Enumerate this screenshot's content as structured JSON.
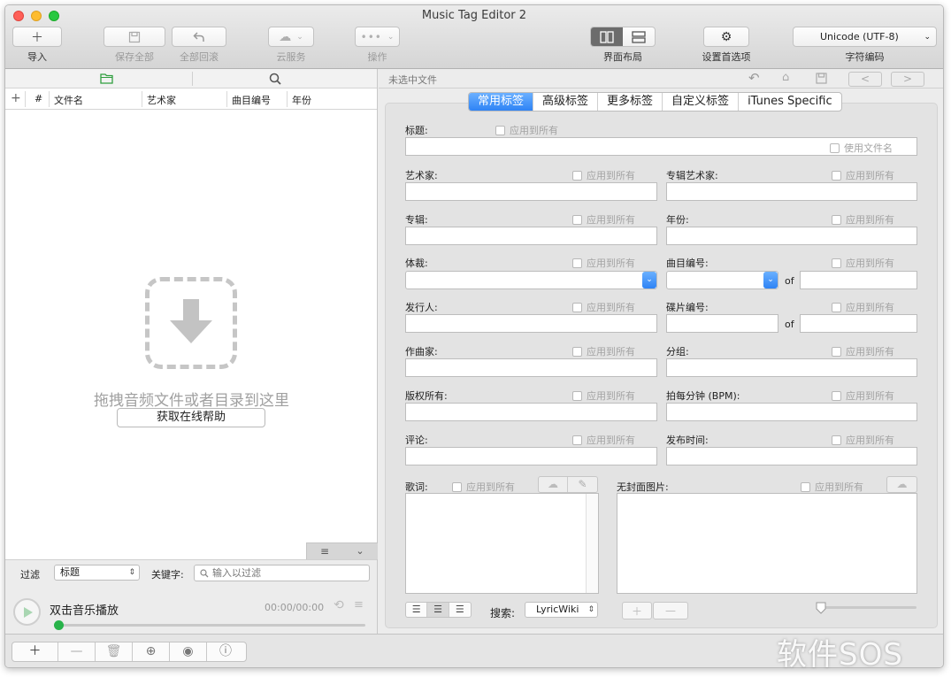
{
  "window": {
    "title": "Music Tag Editor 2",
    "traffic_colors": [
      "#fe5f57",
      "#febc2e",
      "#28c840"
    ]
  },
  "toolbar": {
    "import": {
      "label": "导入",
      "icon": "plus-icon"
    },
    "save_all": {
      "label": "保存全部",
      "icon": "save-icon"
    },
    "revert_all": {
      "label": "全部回滚",
      "icon": "undo-icon"
    },
    "cloud": {
      "label": "云服务",
      "icon": "cloud-icon"
    },
    "actions": {
      "label": "操作",
      "icon": "more-icon"
    },
    "layout": {
      "label": "界面布局"
    },
    "preferences": {
      "label": "设置首选项",
      "icon": "gear-icon"
    },
    "encoding": {
      "label": "字符编码",
      "value": "Unicode (UTF-8)"
    }
  },
  "file_list": {
    "columns": [
      "#",
      "文件名",
      "艺术家",
      "曲目编号",
      "年份"
    ],
    "drop_text": "拖拽音频文件或者目录到这里",
    "help_button": "获取在线帮助"
  },
  "filter": {
    "label": "过滤",
    "field_value": "标题",
    "keyword_label": "关键字:",
    "search_placeholder": "输入以过滤"
  },
  "player": {
    "title": "双击音乐播放",
    "time": "00:00/00:00",
    "progress": 0
  },
  "editor": {
    "status": "未选中文件",
    "tabs": [
      "常用标签",
      "高级标签",
      "更多标签",
      "自定义标签",
      "iTunes Specific"
    ],
    "active_tab": 0,
    "apply_all": "应用到所有",
    "use_filename": "使用文件名",
    "of": "of",
    "fields": {
      "title": "标题:",
      "artist": "艺术家:",
      "album_artist": "专辑艺术家:",
      "album": "专辑:",
      "year": "年份:",
      "genre": "体裁:",
      "track": "曲目编号:",
      "publisher": "发行人:",
      "disc": "碟片编号:",
      "composer": "作曲家:",
      "grouping": "分组:",
      "copyright": "版权所有:",
      "bpm": "拍每分钟 (BPM):",
      "comment": "评论:",
      "release_time": "发布时间:",
      "lyrics": "歌词:",
      "cover": "无封面图片:"
    },
    "lyrics_search_label": "搜索:",
    "lyrics_source": "LyricWiki"
  },
  "watermark": "软件SOS",
  "accent": "#2e83f5"
}
